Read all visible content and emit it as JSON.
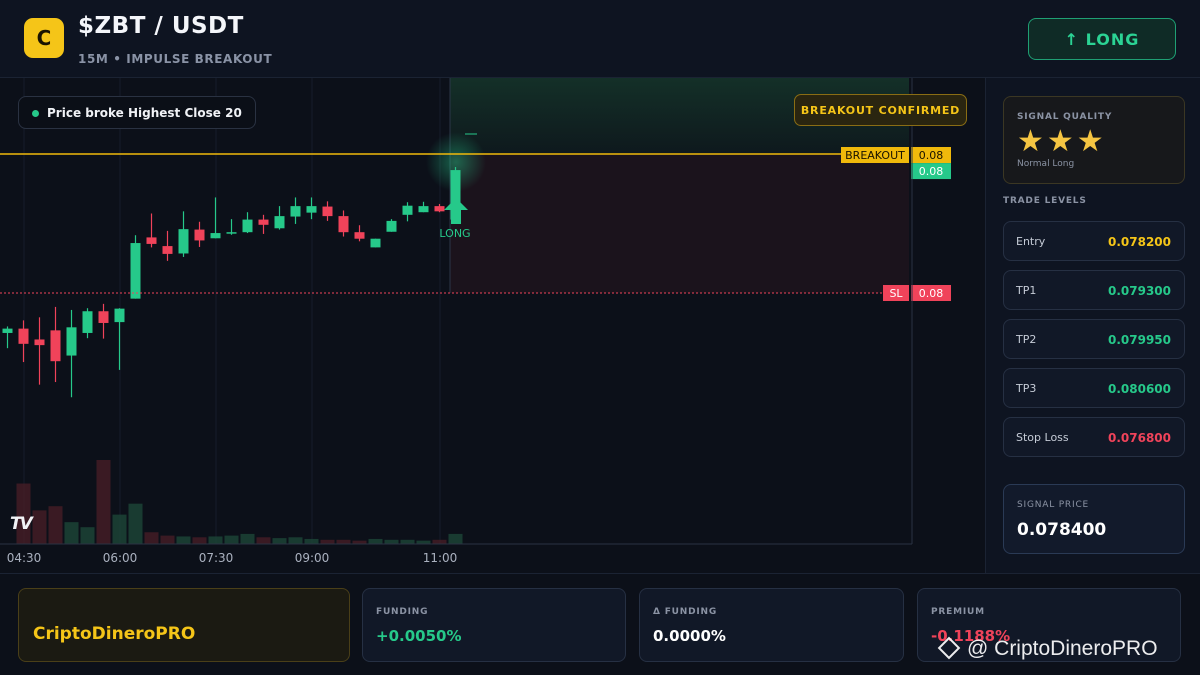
{
  "header": {
    "logo_letter": "C",
    "pair": "$ZBT / USDT",
    "subtitle": "15M • IMPULSE BREAKOUT",
    "direction_button": "↑ LONG"
  },
  "chart": {
    "info_pill": "Price broke Highest Close 20",
    "breakout_badge": "BREAKOUT CONFIRMED",
    "signal_marker_label": "LONG",
    "price_tags": [
      {
        "label": "",
        "value": "0.08",
        "color": "#26c98a"
      },
      {
        "label": "BREAKOUT",
        "value": "0.08",
        "color": "#f0b90b"
      },
      {
        "label": "SL",
        "value": "0.08",
        "color": "#f0435a"
      }
    ],
    "time_labels": [
      "04:30",
      "06:00",
      "07:30",
      "09:00",
      "11:00"
    ],
    "watermark_logo": "TV",
    "colors": {
      "up": "#26c98a",
      "down": "#f0435a",
      "breakout": "#f0b90b"
    }
  },
  "chart_data": {
    "type": "candlestick",
    "x_ticks": [
      "04:30",
      "06:00",
      "07:30",
      "09:00",
      "11:00"
    ],
    "breakout_level": 0.08,
    "stop_loss_level": 0.0768,
    "candles": [
      {
        "o": 0.07588,
        "h": 0.07603,
        "l": 0.07553,
        "c": 0.07598
      },
      {
        "o": 0.07598,
        "h": 0.07617,
        "l": 0.07521,
        "c": 0.07563
      },
      {
        "o": 0.07573,
        "h": 0.07624,
        "l": 0.07469,
        "c": 0.0756
      },
      {
        "o": 0.07594,
        "h": 0.07648,
        "l": 0.07475,
        "c": 0.07523
      },
      {
        "o": 0.07536,
        "h": 0.07641,
        "l": 0.0744,
        "c": 0.07601
      },
      {
        "o": 0.07588,
        "h": 0.07645,
        "l": 0.07576,
        "c": 0.07638
      },
      {
        "o": 0.07638,
        "h": 0.07655,
        "l": 0.07575,
        "c": 0.07611
      },
      {
        "o": 0.07613,
        "h": 0.07645,
        "l": 0.07503,
        "c": 0.07644
      },
      {
        "o": 0.07667,
        "h": 0.07813,
        "l": 0.07667,
        "c": 0.07795
      },
      {
        "o": 0.07808,
        "h": 0.07863,
        "l": 0.07785,
        "c": 0.07793
      },
      {
        "o": 0.07788,
        "h": 0.07823,
        "l": 0.07754,
        "c": 0.0777
      },
      {
        "o": 0.07771,
        "h": 0.07868,
        "l": 0.07763,
        "c": 0.07827
      },
      {
        "o": 0.07826,
        "h": 0.07844,
        "l": 0.07786,
        "c": 0.07801
      },
      {
        "o": 0.07806,
        "h": 0.079,
        "l": 0.07806,
        "c": 0.07818
      },
      {
        "o": 0.07818,
        "h": 0.0785,
        "l": 0.07814,
        "c": 0.0782
      },
      {
        "o": 0.0782,
        "h": 0.07866,
        "l": 0.07818,
        "c": 0.07849
      },
      {
        "o": 0.07849,
        "h": 0.0786,
        "l": 0.07816,
        "c": 0.07837
      },
      {
        "o": 0.07829,
        "h": 0.0788,
        "l": 0.07826,
        "c": 0.07857
      },
      {
        "o": 0.07856,
        "h": 0.079,
        "l": 0.07839,
        "c": 0.0788
      },
      {
        "o": 0.07865,
        "h": 0.079,
        "l": 0.0785,
        "c": 0.0788
      },
      {
        "o": 0.07879,
        "h": 0.07891,
        "l": 0.07846,
        "c": 0.07857
      },
      {
        "o": 0.07857,
        "h": 0.0787,
        "l": 0.0781,
        "c": 0.0782
      },
      {
        "o": 0.0782,
        "h": 0.07836,
        "l": 0.07799,
        "c": 0.07805
      },
      {
        "o": 0.07785,
        "h": 0.07805,
        "l": 0.07785,
        "c": 0.07805
      },
      {
        "o": 0.07821,
        "h": 0.0785,
        "l": 0.07821,
        "c": 0.07846
      },
      {
        "o": 0.0786,
        "h": 0.07889,
        "l": 0.07845,
        "c": 0.07881
      },
      {
        "o": 0.07866,
        "h": 0.0789,
        "l": 0.07866,
        "c": 0.0788
      },
      {
        "o": 0.0788,
        "h": 0.07885,
        "l": 0.07866,
        "c": 0.07868
      },
      {
        "o": 0.07849,
        "h": 0.0797,
        "l": 0.07849,
        "c": 0.07963
      }
    ],
    "volume_relative": [
      0.0,
      0.72,
      0.4,
      0.45,
      0.26,
      0.2,
      1.0,
      0.35,
      0.48,
      0.14,
      0.1,
      0.09,
      0.08,
      0.09,
      0.1,
      0.12,
      0.08,
      0.07,
      0.08,
      0.06,
      0.05,
      0.05,
      0.04,
      0.06,
      0.05,
      0.05,
      0.04,
      0.05,
      0.12
    ]
  },
  "sidebar": {
    "quality_label": "SIGNAL QUALITY",
    "stars": "★★★",
    "quality_note": "Normal Long",
    "levels_title": "TRADE LEVELS",
    "levels": [
      {
        "name": "Entry",
        "value": "0.078200",
        "color": "#f5c518"
      },
      {
        "name": "TP1",
        "value": "0.079300",
        "color": "#26c98a"
      },
      {
        "name": "TP2",
        "value": "0.079950",
        "color": "#26c98a"
      },
      {
        "name": "TP3",
        "value": "0.080600",
        "color": "#26c98a"
      },
      {
        "name": "Stop Loss",
        "value": "0.076800",
        "color": "#f0435a"
      }
    ],
    "signal_price_label": "SIGNAL PRICE",
    "signal_price": "0.078400"
  },
  "footer": {
    "brand": "CriptoDineroPRO",
    "funding_label": "FUNDING",
    "funding_value": "+0.0050%",
    "dfunding_label": "Δ FUNDING",
    "dfunding_value": "0.0000%",
    "premium_label": "PREMIUM",
    "premium_value": "-0.1188%",
    "watermark": "@ CriptoDineroPRO"
  }
}
